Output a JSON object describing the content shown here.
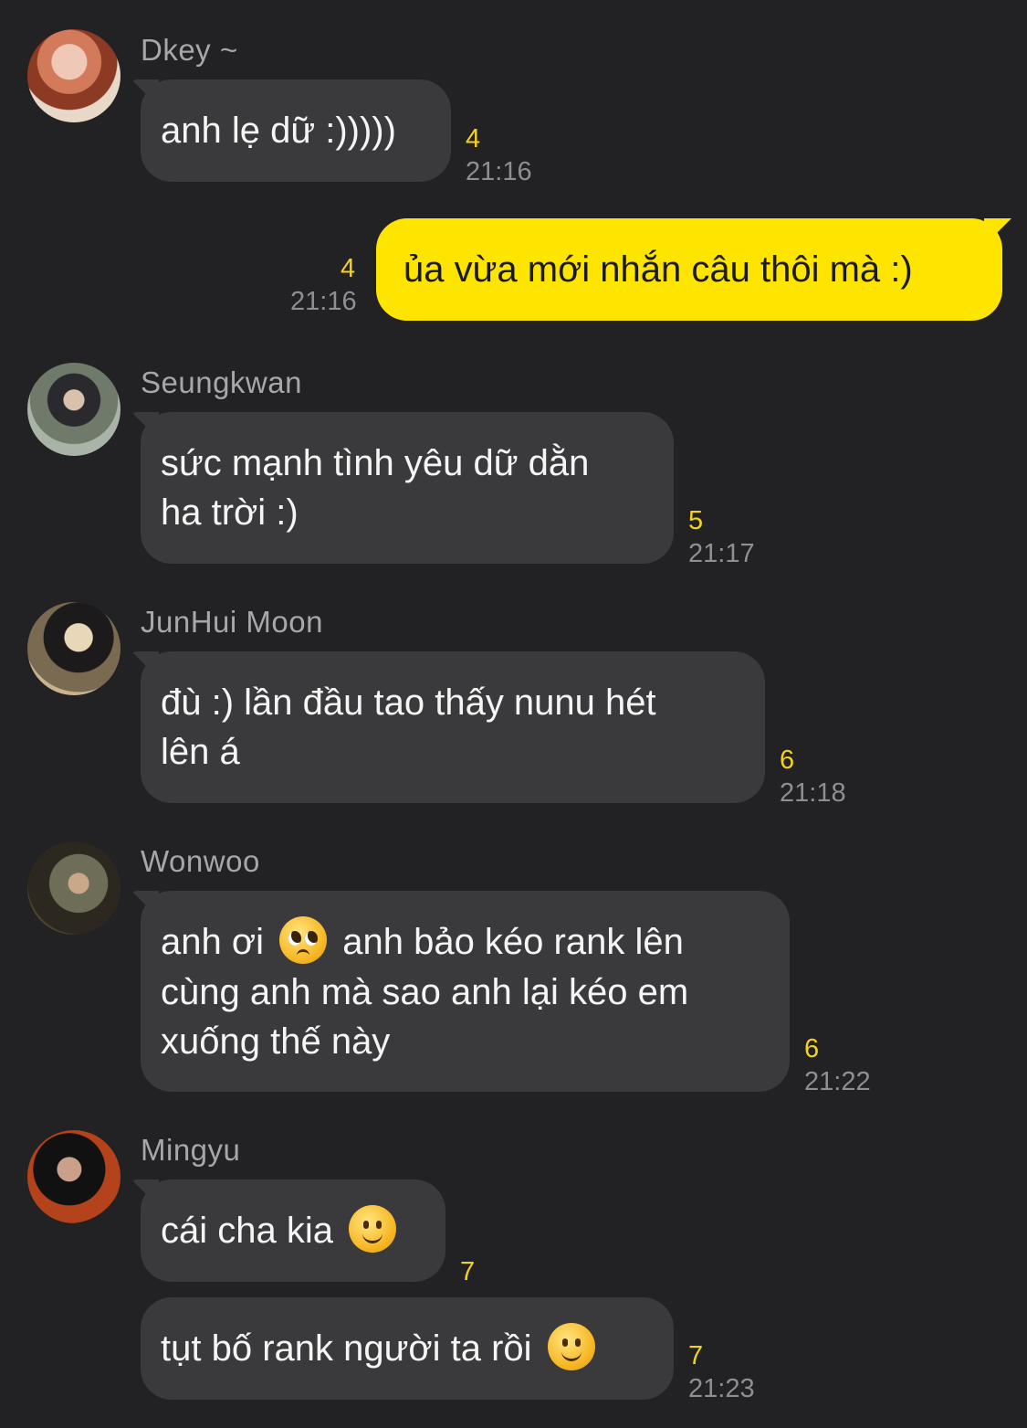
{
  "messages": {
    "m1": {
      "sender": "Dkey ~",
      "text": "anh lẹ dữ :)))))",
      "count": "4",
      "time": "21:16"
    },
    "m2": {
      "text": "ủa vừa mới nhắn câu thôi mà :)",
      "count": "4",
      "time": "21:16"
    },
    "m3": {
      "sender": "Seungkwan",
      "line1": "sức mạnh tình yêu dữ dằn",
      "line2": "ha trời :)",
      "count": "5",
      "time": "21:17"
    },
    "m4": {
      "sender": "JunHui Moon",
      "line1": "đù :) lần đầu tao thấy nunu hét",
      "line2": "lên á",
      "count": "6",
      "time": "21:18"
    },
    "m5": {
      "sender": "Wonwoo",
      "line1a": "anh ơi",
      "emoji": "pleading-face-icon",
      "line1b": "anh bảo kéo rank lên",
      "line2": "cùng anh mà sao anh lại kéo em",
      "line3": "xuống thế này",
      "count": "6",
      "time": "21:22"
    },
    "m6": {
      "sender": "Mingyu",
      "text1": "cái cha kia",
      "emoji1": "slightly-smiling-face-icon",
      "count1": "7",
      "text2": "tụt bố rank người ta rồi",
      "emoji2": "slightly-smiling-face-icon",
      "count2": "7",
      "time": "21:23"
    }
  },
  "colors": {
    "background": "#222224",
    "bubble": "#3a3a3c",
    "my_bubble": "#fee500",
    "unread": "#f5d21b",
    "time": "#8f8f92"
  }
}
